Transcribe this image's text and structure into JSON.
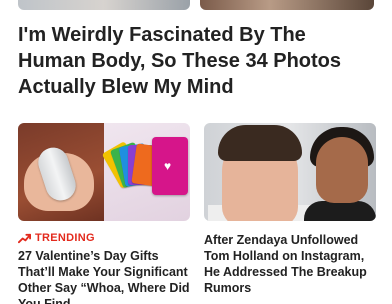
{
  "headline": "I'm Weirdly Fascinated By The Human Body, So These 34 Photos Actually Blew My Mind",
  "cards": [
    {
      "badge": "TRENDING",
      "title": "27 Valentine’s Day Gifts That’ll Make Your Significant Other Say “Whoa, Where Did You Find"
    },
    {
      "title": "After Zendaya Unfollowed Tom Holland on Instagram, He Addressed The Breakup Rumors"
    }
  ],
  "colors": {
    "accent": "#e32a1d",
    "text": "#222222",
    "background": "#ffffff"
  },
  "icons": {
    "trending": "trending-arrow-icon"
  }
}
